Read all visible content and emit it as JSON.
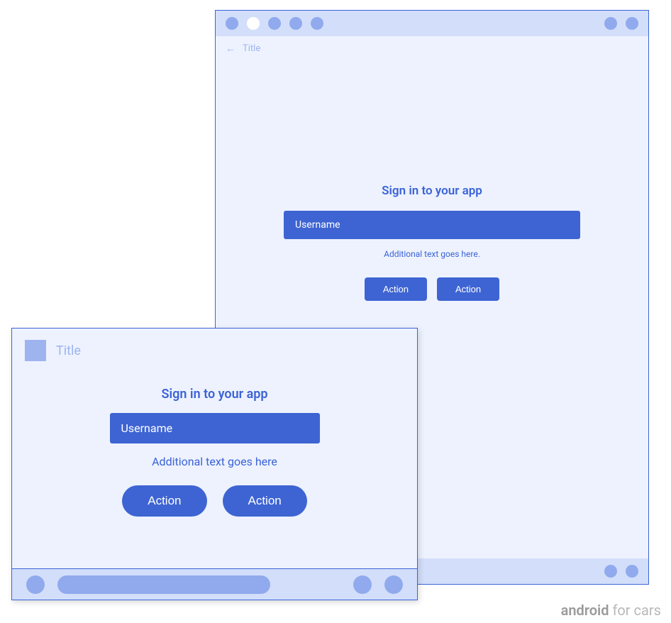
{
  "back": {
    "header_title": "Title",
    "heading": "Sign in to your app",
    "input_placeholder": "Username",
    "subtext": "Additional text goes here.",
    "action1": "Action",
    "action2": "Action"
  },
  "front": {
    "header_title": "Title",
    "heading": "Sign in to your app",
    "input_placeholder": "Username",
    "subtext": "Additional text goes here",
    "action1": "Action",
    "action2": "Action"
  },
  "caption": {
    "bold": "android",
    "rest": " for cars"
  }
}
